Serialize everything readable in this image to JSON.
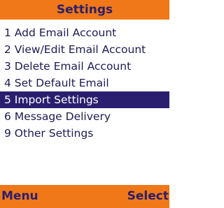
{
  "header": {
    "title": "Settings"
  },
  "menu": {
    "items": [
      {
        "label": "1 Add Email Account"
      },
      {
        "label": "2 View/Edit Email Account"
      },
      {
        "label": "3 Delete Email Account"
      },
      {
        "label": "4 Set Default Email"
      },
      {
        "label": "5 Import Settings"
      },
      {
        "label": "6 Message Delivery"
      },
      {
        "label": "9 Other Settings"
      }
    ],
    "selected_label": "5 Import Settings"
  },
  "softkeys": {
    "left_label": "Menu",
    "right_label": "Select"
  },
  "colors": {
    "accent_orange": "#f07818",
    "selection_navy": "#2a1f6e",
    "text_navy": "#1d1a54",
    "background": "#ffffff"
  }
}
